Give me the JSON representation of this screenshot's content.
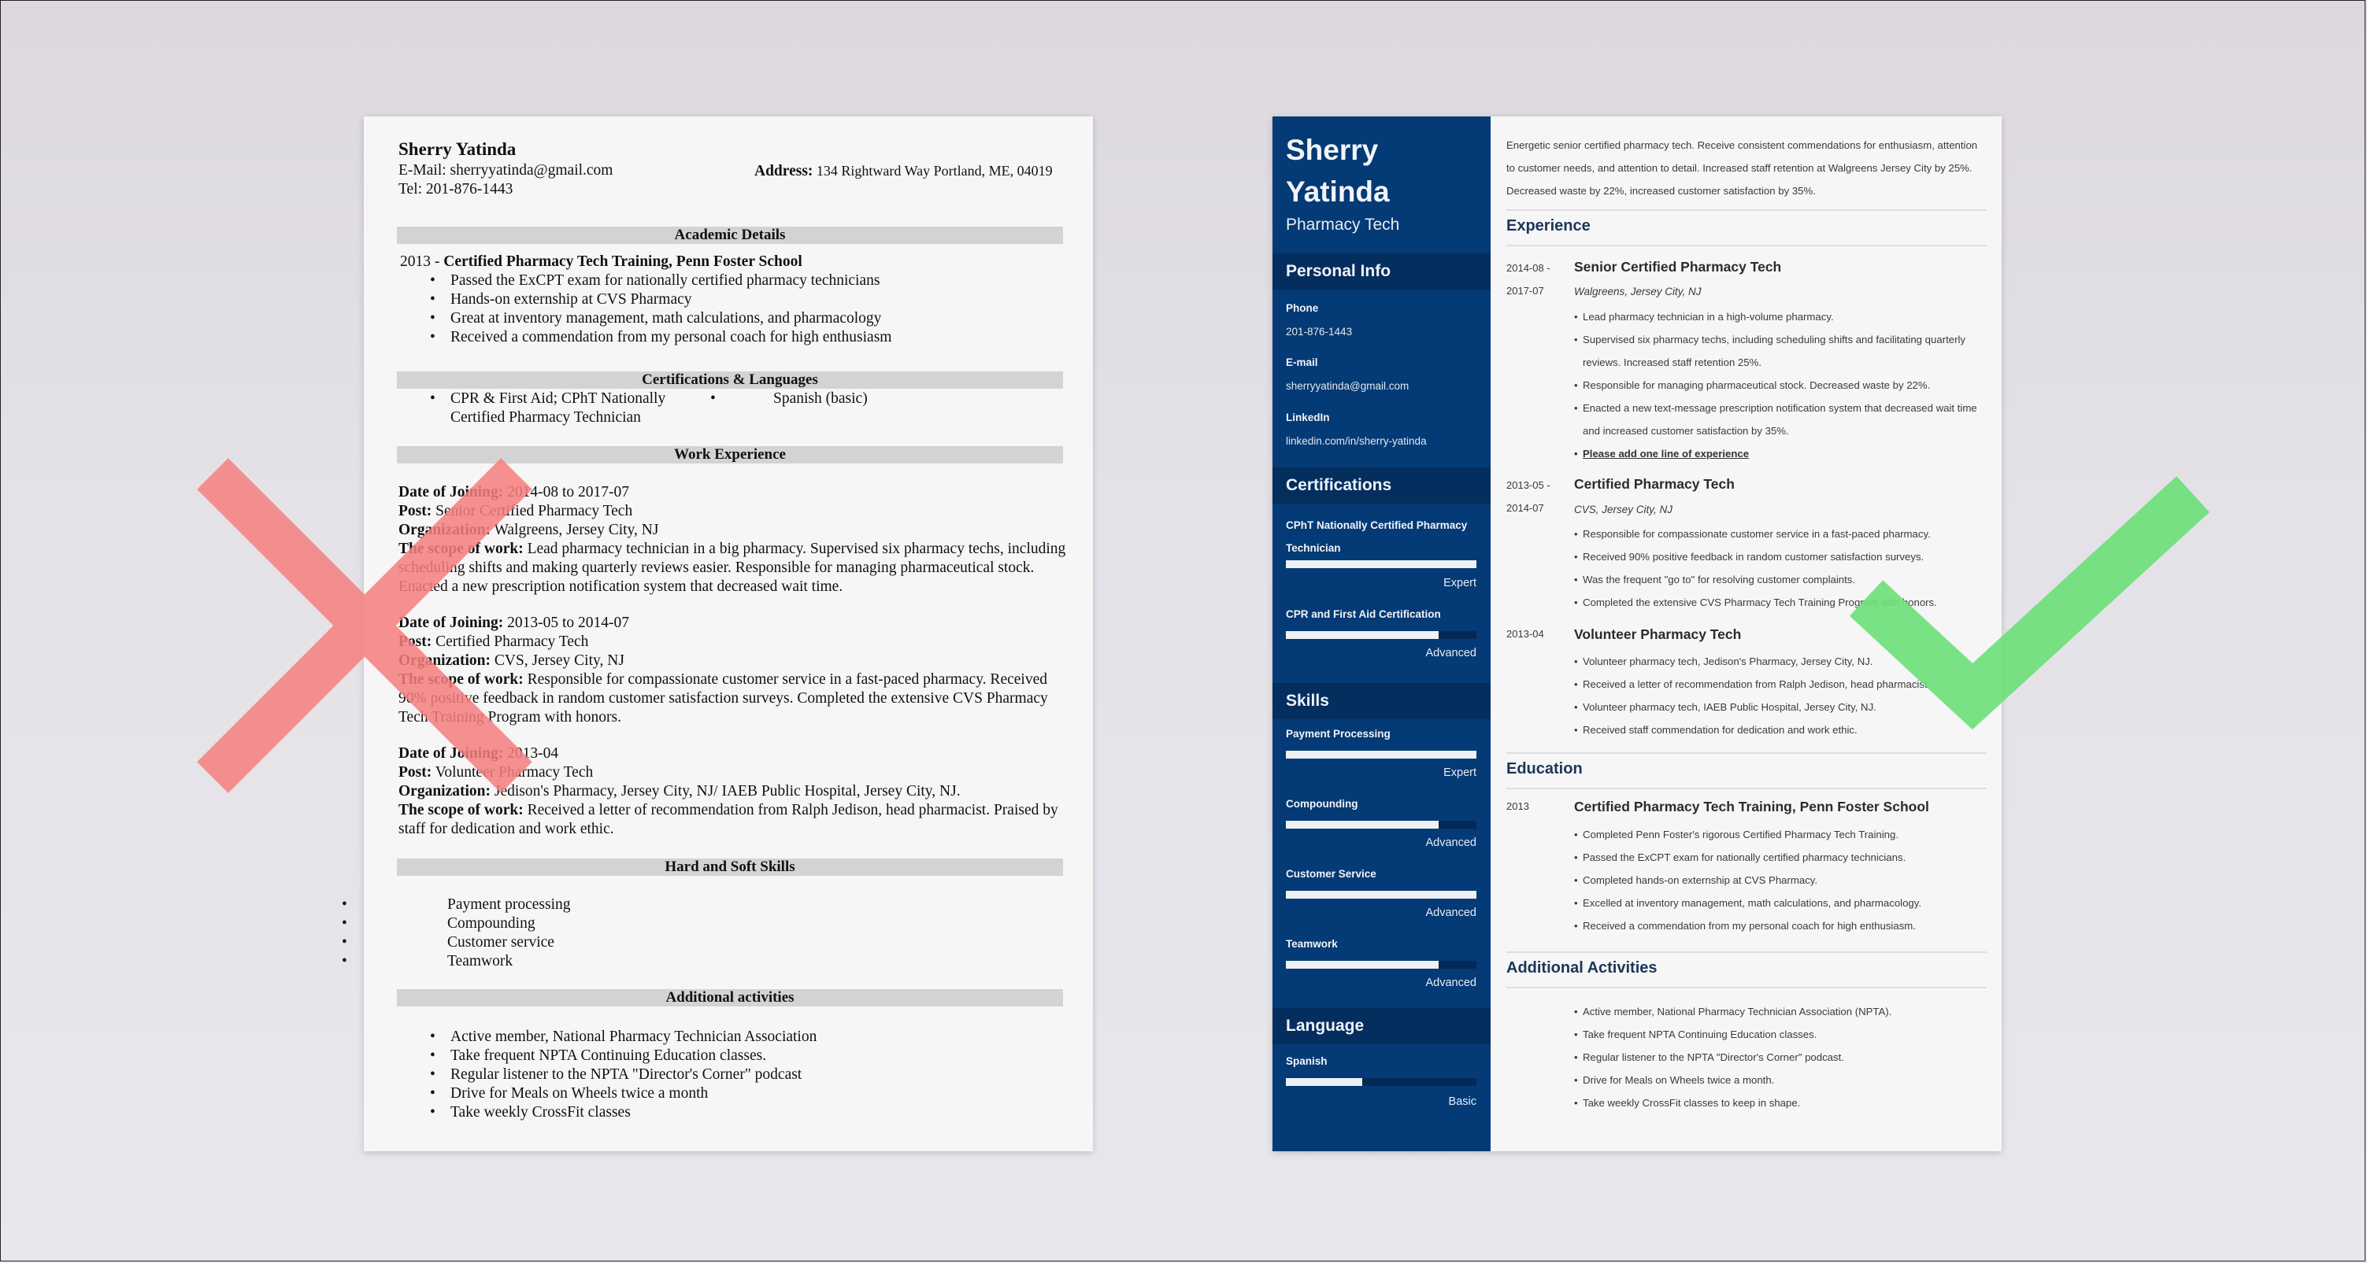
{
  "bad_resume": {
    "name": "Sherry Yatinda",
    "email_label": "E-Mail:",
    "email": "sherryyatinda@gmail.com",
    "tel_label": "Tel:",
    "tel": "201-876-1443",
    "address_label": "Address:",
    "address": "134 Rightward Way Portland, ME, 04019",
    "sections": {
      "academic": "Academic Details",
      "certs": "Certifications & Languages",
      "work": "Work Experience",
      "skills": "Hard and Soft Skills",
      "activities": "Additional activities"
    },
    "education": {
      "year": "2013 - ",
      "title": "Certified Pharmacy Tech Training, Penn Foster School",
      "bullets": [
        "Passed the ExCPT exam for nationally certified pharmacy technicians",
        "Hands-on externship at CVS Pharmacy",
        "Great at inventory management, math calculations, and pharmacology",
        "Received a commendation from my personal coach for high enthusiasm"
      ]
    },
    "certs": [
      "CPR & First Aid; CPhT Nationally Certified Pharmacy Technician",
      "Spanish (basic)"
    ],
    "labels": {
      "date": "Date of Joining:",
      "post": "Post:",
      "org": "Organization:",
      "scope": "The scope of work:"
    },
    "jobs": [
      {
        "date": "2014-08 to 2017-07",
        "post": "Senior Certified Pharmacy Tech",
        "org": "Walgreens, Jersey City, NJ",
        "scope": "Lead pharmacy technician in a big pharmacy. Supervised six pharmacy techs, including scheduling shifts and making quarterly reviews easier. Responsible for managing pharmaceutical stock. Enacted a new prescription notification system that decreased wait time."
      },
      {
        "date": "2013-05 to 2014-07",
        "post": "Certified Pharmacy Tech",
        "org": "CVS, Jersey City, NJ",
        "scope": "Responsible for compassionate customer service in a fast-paced pharmacy. Received 90% positive feedback in random customer satisfaction surveys. Completed the extensive CVS Pharmacy Tech Training Program with honors."
      },
      {
        "date": "2013-04",
        "post": "Volunteer Pharmacy Tech",
        "org": "Jedison's Pharmacy, Jersey City, NJ/ IAEB Public Hospital, Jersey City, NJ.",
        "scope": "Received a letter of recommendation from Ralph Jedison, head pharmacist. Praised by staff for dedication and work ethic."
      }
    ],
    "skills": [
      "Payment processing",
      "Compounding",
      "Customer service",
      "Teamwork"
    ],
    "activities": [
      "Active member, National Pharmacy Technician Association",
      "Take frequent NPTA Continuing Education classes.",
      "Regular listener to the NPTA \"Director's Corner\" podcast",
      "Drive for Meals on Wheels twice a month",
      "Take weekly CrossFit classes"
    ]
  },
  "good_resume": {
    "first_name": "Sherry",
    "last_name": "Yatinda",
    "role": "Pharmacy Tech",
    "sidebar": {
      "personal_info_heading": "Personal Info",
      "phone_label": "Phone",
      "phone": "201-876-1443",
      "email_label": "E-mail",
      "email": "sherryyatinda@gmail.com",
      "linkedin_label": "LinkedIn",
      "linkedin": "linkedin.com/in/sherry-yatinda",
      "certifications_heading": "Certifications",
      "certifications": [
        {
          "name": "CPhT Nationally Certified Pharmacy Technician",
          "level": "Expert",
          "fill": 1.0
        },
        {
          "name": "CPR and First Aid Certification",
          "level": "Advanced",
          "fill": 0.8
        }
      ],
      "skills_heading": "Skills",
      "skills": [
        {
          "name": "Payment Processing",
          "level": "Expert",
          "fill": 1.0
        },
        {
          "name": "Compounding",
          "level": "Advanced",
          "fill": 0.8
        },
        {
          "name": "Customer Service",
          "level": "Advanced",
          "fill": 1.0
        },
        {
          "name": "Teamwork",
          "level": "Advanced",
          "fill": 0.8
        }
      ],
      "language_heading": "Language",
      "languages": [
        {
          "name": "Spanish",
          "level": "Basic",
          "fill": 0.4
        }
      ],
      "colors": {
        "sidebar": "#043a75",
        "heading_band": "#032e5e"
      }
    },
    "summary": "Energetic senior certified pharmacy tech. Receive consistent commendations for enthusiasm, attention to customer needs, and attention to detail. Increased staff retention at Walgreens Jersey City by 25%. Decreased waste by 22%, increased customer satisfaction by 35%.",
    "experience_heading": "Experience",
    "jobs": [
      {
        "date_start": "2014-08 -",
        "date_end": "2017-07",
        "title": "Senior Certified Pharmacy Tech",
        "company": "Walgreens, Jersey City, NJ",
        "bullets": [
          "Lead pharmacy technician in a high-volume pharmacy.",
          "Supervised six pharmacy techs, including scheduling shifts and facilitating quarterly reviews. Increased staff retention 25%.",
          "Responsible for managing pharmaceutical stock. Decreased waste by 22%.",
          "Enacted a new text-message prescription notification system that decreased wait time and increased customer satisfaction by 35%."
        ],
        "prompt": "Please add one line of experience"
      },
      {
        "date_start": "2013-05 -",
        "date_end": "2014-07",
        "title": "Certified Pharmacy Tech",
        "company": "CVS, Jersey City, NJ",
        "bullets": [
          "Responsible for compassionate customer service in a fast-paced pharmacy.",
          "Received 90% positive feedback in random customer satisfaction surveys.",
          "Was the frequent \"go to\" for resolving customer complaints.",
          "Completed the extensive CVS Pharmacy Tech Training Program with honors."
        ]
      },
      {
        "date_start": "2013-04",
        "title": "Volunteer Pharmacy Tech",
        "bullets": [
          "Volunteer pharmacy tech, Jedison's Pharmacy, Jersey City, NJ.",
          "Received a letter of recommendation from Ralph Jedison, head pharmacist.",
          "Volunteer pharmacy tech, IAEB Public Hospital, Jersey City, NJ.",
          "Received staff commendation for dedication and work ethic."
        ]
      }
    ],
    "education_heading": "Education",
    "education": {
      "year": "2013",
      "title": "Certified Pharmacy Tech Training, Penn Foster School",
      "bullets": [
        "Completed Penn Foster's rigorous Certified Pharmacy Tech Training.",
        "Passed the ExCPT exam for nationally certified pharmacy technicians.",
        "Completed hands-on externship at CVS Pharmacy.",
        "Excelled at inventory management, math calculations, and pharmacology.",
        "Received a commendation from my personal coach for high enthusiasm."
      ]
    },
    "activities_heading": "Additional Activities",
    "activities": [
      "Active member, National Pharmacy Technician Association (NPTA).",
      "Take frequent NPTA Continuing Education classes.",
      "Regular listener to the NPTA \"Director's Corner\" podcast.",
      "Drive for Meals on Wheels twice a month.",
      "Take weekly CrossFit classes to keep in shape."
    ]
  },
  "overlays": {
    "cross_icon": "red-x",
    "check_icon": "green-check",
    "cross_color": "#f77f7f",
    "check_color": "#6ee07a"
  }
}
